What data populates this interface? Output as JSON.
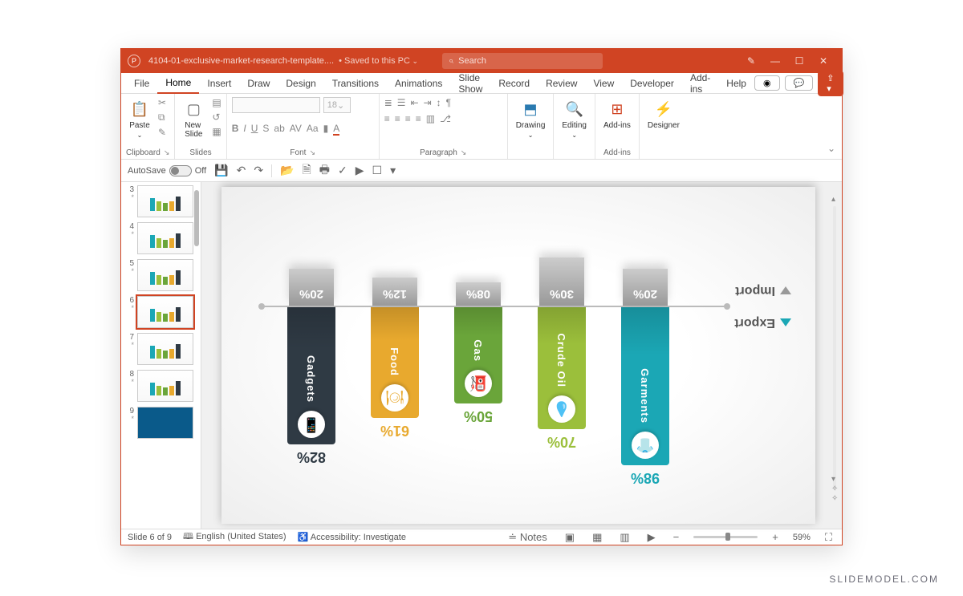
{
  "titlebar": {
    "filename": "4104-01-exclusive-market-research-template....",
    "saved_label": "Saved to this PC",
    "search_placeholder": "Search"
  },
  "tabs": [
    "File",
    "Home",
    "Insert",
    "Draw",
    "Design",
    "Transitions",
    "Animations",
    "Slide Show",
    "Record",
    "Review",
    "View",
    "Developer",
    "Add-ins",
    "Help"
  ],
  "active_tab": "Home",
  "ribbon": {
    "clipboard": {
      "paste": "Paste",
      "label": "Clipboard"
    },
    "slides": {
      "new_slide": "New\nSlide",
      "label": "Slides"
    },
    "font": {
      "size": "18",
      "label": "Font"
    },
    "paragraph": {
      "label": "Paragraph"
    },
    "drawing": {
      "btn": "Drawing",
      "label": ""
    },
    "editing": {
      "btn": "Editing",
      "label": ""
    },
    "addins": {
      "btn": "Add-ins",
      "label": "Add-ins"
    },
    "designer": {
      "btn": "Designer"
    }
  },
  "qat": {
    "autosave": "AutoSave",
    "off": "Off"
  },
  "thumbnails": [
    {
      "n": "3"
    },
    {
      "n": "4"
    },
    {
      "n": "5"
    },
    {
      "n": "6",
      "active": true
    },
    {
      "n": "7"
    },
    {
      "n": "8"
    },
    {
      "n": "9"
    }
  ],
  "chart_data": {
    "type": "bar",
    "categories": [
      "Garments",
      "Crude Oil",
      "Gas",
      "Food",
      "Gadgets"
    ],
    "series": [
      {
        "name": "Export",
        "values": [
          98,
          70,
          50,
          61,
          82
        ]
      },
      {
        "name": "Import",
        "values": [
          20,
          30,
          8,
          12,
          20
        ]
      }
    ],
    "colors": [
      "#1ba7b5",
      "#9bbf3b",
      "#6aa53a",
      "#e8a92e",
      "#2f3a44"
    ],
    "legend": {
      "export": "Export",
      "import": "Import"
    },
    "title": "",
    "xlabel": "",
    "ylabel": "",
    "ylim": [
      0,
      100
    ]
  },
  "status": {
    "slide_pos": "Slide 6 of 9",
    "lang": "English (United States)",
    "access": "Accessibility: Investigate",
    "notes": "Notes",
    "zoom": "59%"
  },
  "watermark": "SLIDEMODEL.COM"
}
